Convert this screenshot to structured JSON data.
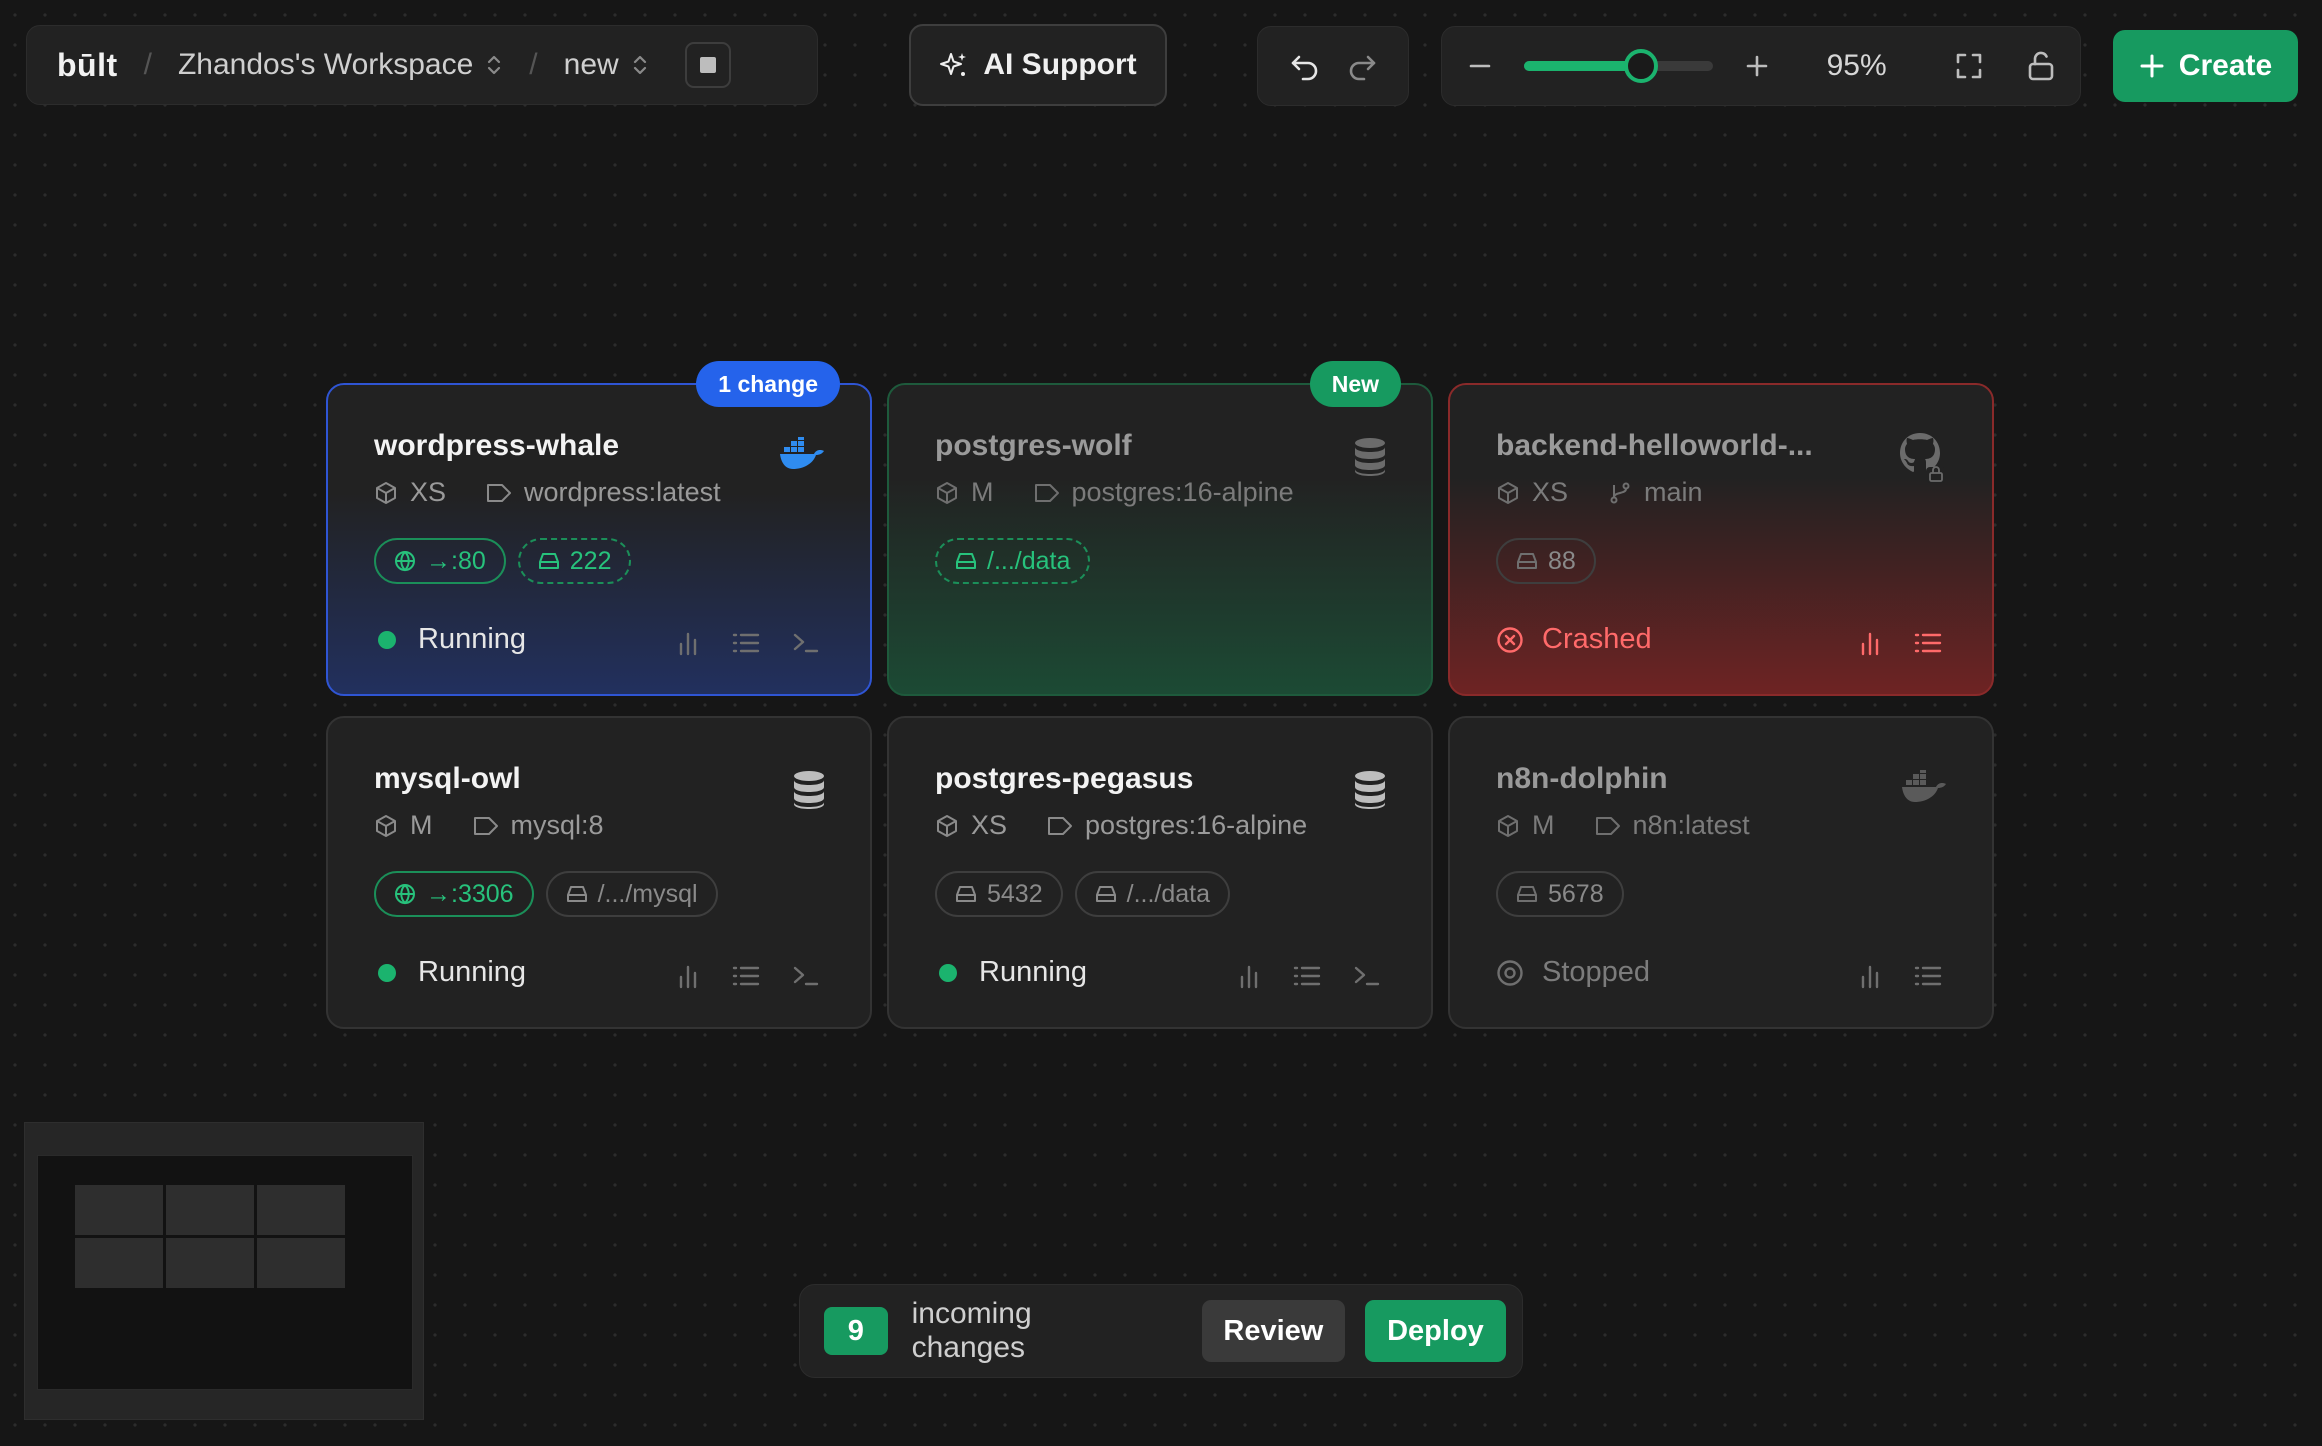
{
  "header": {
    "logo": "būlt",
    "separator": "/",
    "workspace": "Zhandos's Workspace",
    "environment": "new",
    "ai_support_label": "AI Support",
    "zoom_level": "95%",
    "zoom_fraction": 0.62,
    "create_label": "Create"
  },
  "cards": [
    {
      "name": "wordpress-whale",
      "size": "XS",
      "source": "wordpress:latest",
      "badge": "1 change",
      "port_pill": "→:80",
      "volume_pill": "222",
      "status": "Running",
      "type_icon": "docker-icon"
    },
    {
      "name": "postgres-wolf",
      "size": "M",
      "source": "postgres:16-alpine",
      "badge": "New",
      "volume_pill": "/.../data",
      "type_icon": "database-icon"
    },
    {
      "name": "backend-helloworld-...",
      "size": "XS",
      "source": "main",
      "volume_pill": "88",
      "status": "Crashed",
      "type_icon": "github-icon"
    },
    {
      "name": "mysql-owl",
      "size": "M",
      "source": "mysql:8",
      "port_pill": "→:3306",
      "volume_pill": "/.../mysql",
      "status": "Running",
      "type_icon": "database-icon"
    },
    {
      "name": "postgres-pegasus",
      "size": "XS",
      "source": "postgres:16-alpine",
      "port_pill": "5432",
      "volume_pill": "/.../data",
      "status": "Running",
      "type_icon": "database-icon"
    },
    {
      "name": "n8n-dolphin",
      "size": "M",
      "source": "n8n:latest",
      "port_pill": "5678",
      "status": "Stopped",
      "type_icon": "docker-icon"
    }
  ],
  "deploy_bar": {
    "count": "9",
    "label": "incoming changes",
    "review_label": "Review",
    "deploy_label": "Deploy"
  },
  "colors": {
    "accent_green": "#179a60",
    "running_dot": "#1bb36e",
    "changed_blue": "#2f55d4",
    "crashed_red": "#ff6a6a"
  }
}
